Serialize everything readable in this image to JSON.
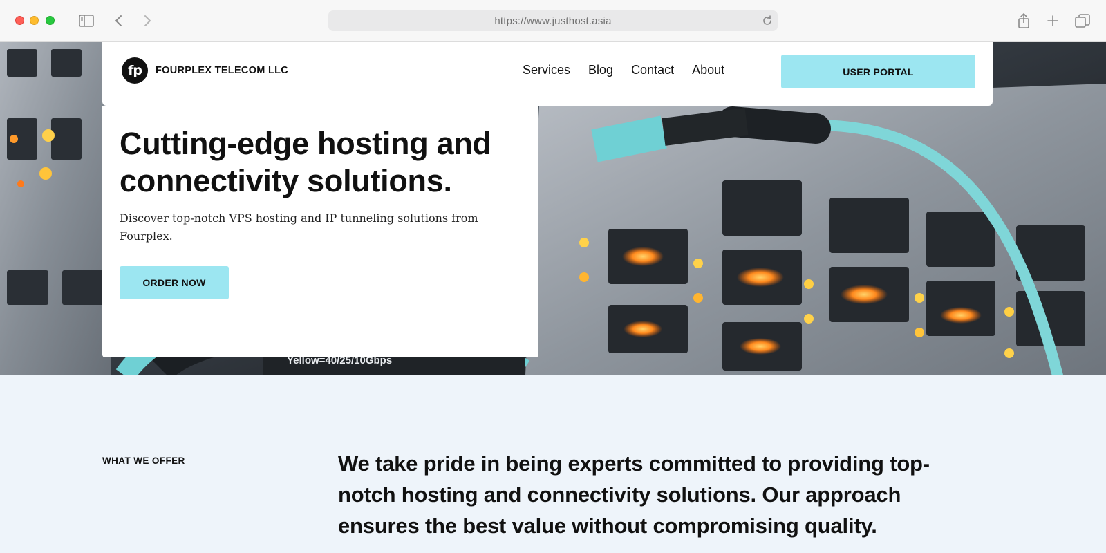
{
  "browser": {
    "url": "https://www.justhost.asia",
    "icons": [
      "sidebar-icon",
      "back-icon",
      "forward-icon",
      "reload-icon",
      "share-icon",
      "new-tab-icon",
      "tabs-overview-icon"
    ]
  },
  "header": {
    "logo_text": "fp",
    "company_name": "FOURPLEX TELECOM LLC",
    "nav": [
      {
        "label": "Services"
      },
      {
        "label": "Blog"
      },
      {
        "label": "Contact"
      },
      {
        "label": "About"
      }
    ],
    "portal_label": "USER PORTAL"
  },
  "hero": {
    "title": "Cutting-edge hosting and connectivity solutions.",
    "description": "Discover top-notch VPS hosting and IP tunneling solutions from Fourplex.",
    "cta_label": "ORDER NOW",
    "image_caption": "Yellow=40/25/10Gbps"
  },
  "offer": {
    "label": "WHAT WE OFFER",
    "text": "We take pride in being experts committed to providing top-notch hosting and connectivity solutions. Our approach ensures the best value without compromising quality."
  },
  "colors": {
    "accent": "#9ce6f1",
    "section_bg": "#eef4fa",
    "text": "#111111"
  }
}
